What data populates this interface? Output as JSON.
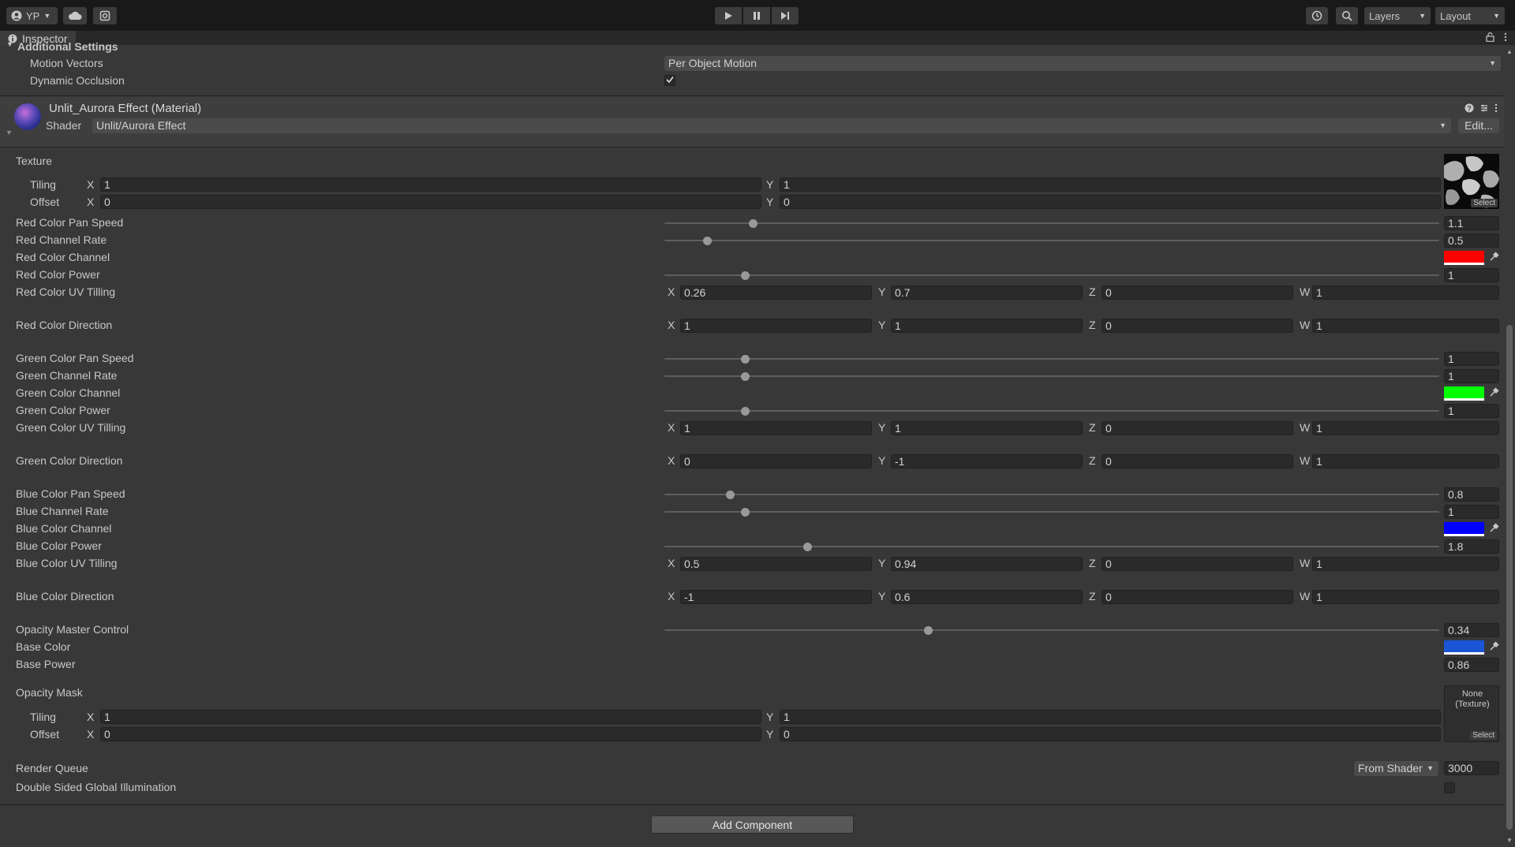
{
  "toolbar": {
    "account_label": "YP",
    "layers_label": "Layers",
    "layout_label": "Layout"
  },
  "tab": {
    "title": "Inspector"
  },
  "additional_settings": {
    "header": "Additional Settings",
    "motion_vectors_label": "Motion Vectors",
    "motion_vectors_value": "Per Object Motion",
    "dynamic_occlusion_label": "Dynamic Occlusion",
    "dynamic_occlusion_checked": true
  },
  "material": {
    "title": "Unlit_Aurora Effect (Material)",
    "shader_label": "Shader",
    "shader_value": "Unlit/Aurora Effect",
    "edit_label": "Edit..."
  },
  "texture": {
    "label": "Texture",
    "tiling_label": "Tiling",
    "offset_label": "Offset",
    "tiling_x": "1",
    "tiling_y": "1",
    "offset_x": "0",
    "offset_y": "0",
    "select_label": "Select"
  },
  "props": {
    "red_pan_speed": {
      "label": "Red Color Pan Speed",
      "value": "1.1",
      "fraction": 0.114
    },
    "red_channel_rate": {
      "label": "Red Channel Rate",
      "value": "0.5",
      "fraction": 0.055
    },
    "red_color_channel": {
      "label": "Red Color Channel",
      "color": "#ff0000"
    },
    "red_color_power": {
      "label": "Red Color Power",
      "value": "1",
      "fraction": 0.104
    },
    "red_uv_tilling": {
      "label": "Red Color UV Tilling",
      "x": "0.26",
      "y": "0.7",
      "z": "0",
      "w": "1"
    },
    "red_direction": {
      "label": "Red Color Direction",
      "x": "1",
      "y": "1",
      "z": "0",
      "w": "1"
    },
    "green_pan_speed": {
      "label": "Green Color Pan Speed",
      "value": "1",
      "fraction": 0.104
    },
    "green_channel_rate": {
      "label": "Green Channel Rate",
      "value": "1",
      "fraction": 0.104
    },
    "green_color_channel": {
      "label": "Green Color Channel",
      "color": "#00ff00"
    },
    "green_color_power": {
      "label": "Green Color Power",
      "value": "1",
      "fraction": 0.104
    },
    "green_uv_tilling": {
      "label": "Green Color UV Tilling",
      "x": "1",
      "y": "1",
      "z": "0",
      "w": "1"
    },
    "green_direction": {
      "label": "Green Color Direction",
      "x": "0",
      "y": "-1",
      "z": "0",
      "w": "1"
    },
    "blue_pan_speed": {
      "label": "Blue Color Pan Speed",
      "value": "0.8",
      "fraction": 0.085
    },
    "blue_channel_rate": {
      "label": "Blue Channel Rate",
      "value": "1",
      "fraction": 0.104
    },
    "blue_color_channel": {
      "label": "Blue Color Channel",
      "color": "#0000ff"
    },
    "blue_color_power": {
      "label": "Blue Color Power",
      "value": "1.8",
      "fraction": 0.184
    },
    "blue_uv_tilling": {
      "label": "Blue Color UV Tilling",
      "x": "0.5",
      "y": "0.94",
      "z": "0",
      "w": "1"
    },
    "blue_direction": {
      "label": "Blue Color Direction",
      "x": "-1",
      "y": "0.6",
      "z": "0",
      "w": "1"
    },
    "opacity_master": {
      "label": "Opacity Master Control",
      "value": "0.34",
      "fraction": 0.34
    },
    "base_color": {
      "label": "Base Color",
      "color": "#1a55d6"
    },
    "base_power": {
      "label": "Base Power",
      "value": "0.86"
    }
  },
  "opacity_mask": {
    "label": "Opacity Mask",
    "tiling_label": "Tiling",
    "offset_label": "Offset",
    "tiling_x": "1",
    "tiling_y": "1",
    "offset_x": "0",
    "offset_y": "0",
    "none_label": "None\n(Texture)",
    "select_label": "Select"
  },
  "render_queue": {
    "label": "Render Queue",
    "mode": "From Shader",
    "value": "3000"
  },
  "double_sided_gi": {
    "label": "Double Sided Global Illumination",
    "checked": false
  },
  "add_component_label": "Add Component",
  "axis_letters": {
    "x": "X",
    "y": "Y",
    "z": "Z",
    "w": "W"
  }
}
